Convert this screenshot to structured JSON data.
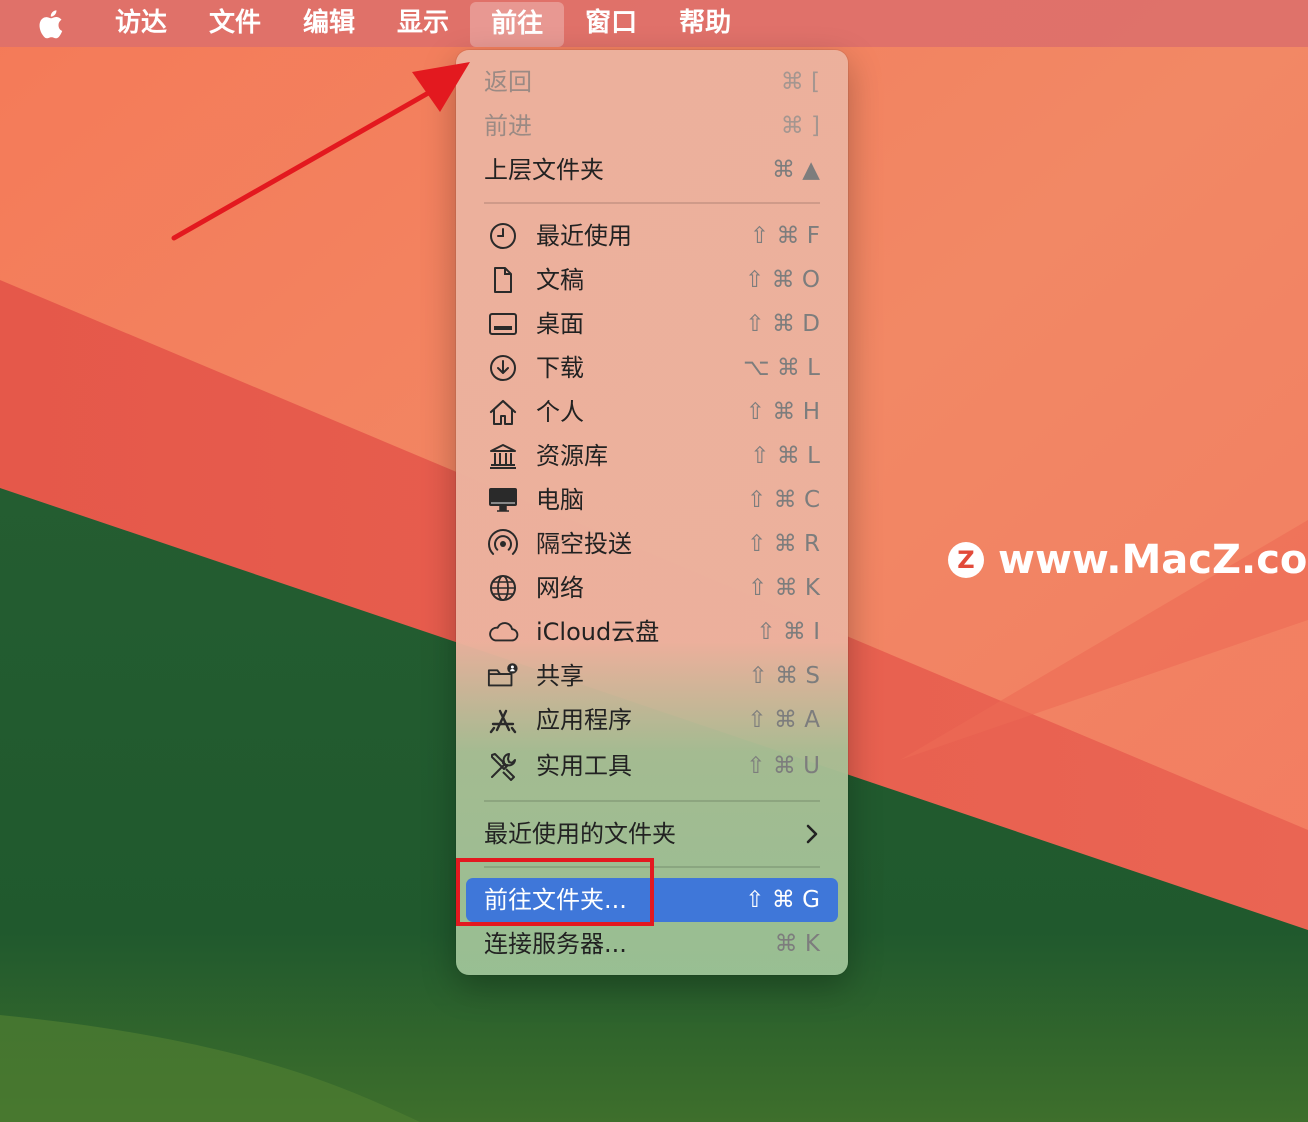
{
  "menubar": {
    "items": [
      "访达",
      "文件",
      "编辑",
      "显示",
      "前往",
      "窗口",
      "帮助"
    ],
    "active_index": 4
  },
  "menu": {
    "nav": [
      {
        "label": "返回",
        "shortcut": "⌘ [",
        "disabled": true
      },
      {
        "label": "前进",
        "shortcut": "⌘ ]",
        "disabled": true
      },
      {
        "label": "上层文件夹",
        "shortcut": "⌘ ▲",
        "disabled": false
      }
    ],
    "places": [
      {
        "label": "最近使用",
        "shortcut": "⇧ ⌘ F",
        "icon": "clock-icon"
      },
      {
        "label": "文稿",
        "shortcut": "⇧ ⌘ O",
        "icon": "document-icon"
      },
      {
        "label": "桌面",
        "shortcut": "⇧ ⌘ D",
        "icon": "desktop-icon"
      },
      {
        "label": "下载",
        "shortcut": "⌥ ⌘ L",
        "icon": "download-icon"
      },
      {
        "label": "个人",
        "shortcut": "⇧ ⌘ H",
        "icon": "home-icon"
      },
      {
        "label": "资源库",
        "shortcut": "⇧ ⌘ L",
        "icon": "library-icon"
      },
      {
        "label": "电脑",
        "shortcut": "⇧ ⌘ C",
        "icon": "computer-icon"
      },
      {
        "label": "隔空投送",
        "shortcut": "⇧ ⌘ R",
        "icon": "airdrop-icon"
      },
      {
        "label": "网络",
        "shortcut": "⇧ ⌘ K",
        "icon": "network-icon"
      },
      {
        "label": "iCloud云盘",
        "shortcut": "⇧ ⌘ I",
        "icon": "cloud-icon"
      },
      {
        "label": "共享",
        "shortcut": "⇧ ⌘ S",
        "icon": "shared-folder-icon"
      },
      {
        "label": "应用程序",
        "shortcut": "⇧ ⌘ A",
        "icon": "applications-icon"
      },
      {
        "label": "实用工具",
        "shortcut": "⇧ ⌘ U",
        "icon": "utilities-icon"
      }
    ],
    "recent_folders": {
      "label": "最近使用的文件夹"
    },
    "goto_folder": {
      "label": "前往文件夹...",
      "shortcut": "⇧ ⌘ G"
    },
    "connect_server": {
      "label": "连接服务器...",
      "shortcut": "⌘ K"
    }
  },
  "watermark": {
    "logo": "Z",
    "text": "www.MacZ.com"
  },
  "colors": {
    "highlight": "#3f77d9",
    "annotation": "#e3191f"
  }
}
